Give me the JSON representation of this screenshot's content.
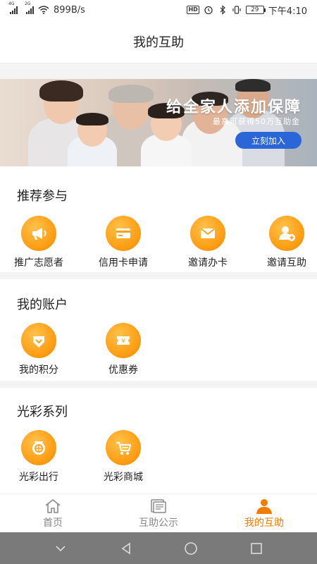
{
  "status_bar": {
    "signal1_tag": "4G",
    "signal2_tag": "2G",
    "speed": "899B/s",
    "hd": "HD",
    "battery": "29",
    "time": "下午4:10"
  },
  "header": {
    "title": "我的互助"
  },
  "banner": {
    "headline": "给全家人添加保障",
    "subline": "最高可获得50万互助金",
    "button": "立刻加入"
  },
  "recommend": {
    "title": "推荐参与",
    "items": [
      {
        "label": "推广志愿者",
        "icon": "megaphone-icon"
      },
      {
        "label": "信用卡申请",
        "icon": "credit-card-icon"
      },
      {
        "label": "邀请办卡",
        "icon": "envelope-icon"
      },
      {
        "label": "邀请互助",
        "icon": "add-user-icon"
      }
    ]
  },
  "account": {
    "title": "我的账户",
    "items": [
      {
        "label": "我的积分",
        "icon": "points-badge-icon"
      },
      {
        "label": "优惠券",
        "icon": "coupon-icon"
      }
    ]
  },
  "series": {
    "title": "光彩系列",
    "items": [
      {
        "label": "光彩出行",
        "icon": "travel-icon"
      },
      {
        "label": "光彩商城",
        "icon": "shopping-cart-icon"
      }
    ]
  },
  "bottom_nav": {
    "items": [
      {
        "label": "首页",
        "icon": "home-icon",
        "active": false
      },
      {
        "label": "互助公示",
        "icon": "notice-icon",
        "active": false
      },
      {
        "label": "我的互助",
        "icon": "person-icon",
        "active": true
      }
    ]
  },
  "colors": {
    "accent": "#f07c00",
    "icon_orange": "#ffa21a",
    "banner_button": "#2b66d9"
  }
}
